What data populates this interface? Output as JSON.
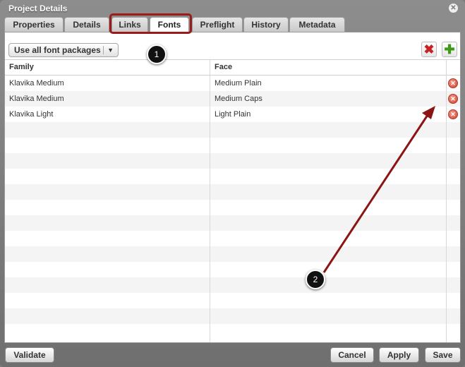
{
  "window": {
    "title": "Project Details",
    "close_glyph": "✕"
  },
  "tabs": [
    {
      "label": "Properties"
    },
    {
      "label": "Details"
    },
    {
      "label": "Links"
    },
    {
      "label": "Fonts",
      "active": true
    },
    {
      "label": "Preflight"
    },
    {
      "label": "History"
    },
    {
      "label": "Metadata"
    }
  ],
  "toolbar": {
    "package_select": {
      "value": "Use all font packages",
      "arrow": "▼"
    },
    "remove_icon": "✖",
    "add_icon": "✚"
  },
  "table": {
    "columns": [
      "Family",
      "Face"
    ],
    "rows": [
      {
        "family": "Klavika Medium",
        "face": "Medium Plain"
      },
      {
        "family": "Klavika Medium",
        "face": "Medium Caps"
      },
      {
        "family": "Klavika Light",
        "face": "Light Plain"
      }
    ],
    "row_delete_glyph": "✕"
  },
  "annotations": {
    "marker_1": "1",
    "marker_2": "2",
    "highlight_color": "#9a1b1b"
  },
  "footer": {
    "validate_label": "Validate",
    "cancel_label": "Cancel",
    "apply_label": "Apply",
    "save_label": "Save"
  }
}
